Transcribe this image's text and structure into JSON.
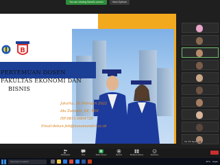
{
  "share_bar": {
    "sharing_text": "You are viewing Bandi's screen",
    "view_options": "View Options"
  },
  "slide": {
    "title_line1": "PERTEMUAN DOSEN",
    "title_line2": "FAKULTAS EKONOMI DAN",
    "title_line3": "BISNIS",
    "date": "Jakarta, 26 Februari 2022",
    "speaker": "Ida Zuniarti, SE, MM",
    "phone": "HP:0811-9804720",
    "email": "Email:dekan.feb@nusamandiri.ac.id",
    "colors": {
      "band": "#f3a91e",
      "title_bar": "#1c3f96",
      "script": "#d9811a"
    }
  },
  "participants": [
    {
      "name": ""
    },
    {
      "name": ""
    },
    {
      "name": ""
    },
    {
      "name": ""
    },
    {
      "name": ""
    },
    {
      "name": ""
    },
    {
      "name": ""
    },
    {
      "name": ""
    },
    {
      "name": ""
    },
    {
      "name": "Dra. Rini Ngrawitoe"
    }
  ],
  "controls": [
    {
      "icon": "participants-icon",
      "label": "Participants"
    },
    {
      "icon": "chat-icon",
      "label": "Chat"
    },
    {
      "icon": "share-screen-icon",
      "label": "Share Screen"
    },
    {
      "icon": "record-icon",
      "label": "Record"
    },
    {
      "icon": "breakout-rooms-icon",
      "label": "Breakout Rooms"
    },
    {
      "icon": "reactions-icon",
      "label": "Reactions"
    }
  ],
  "taskbar": {
    "search_placeholder": "Type here to search",
    "weather": "25°C",
    "tray_extra": "Hujan"
  }
}
